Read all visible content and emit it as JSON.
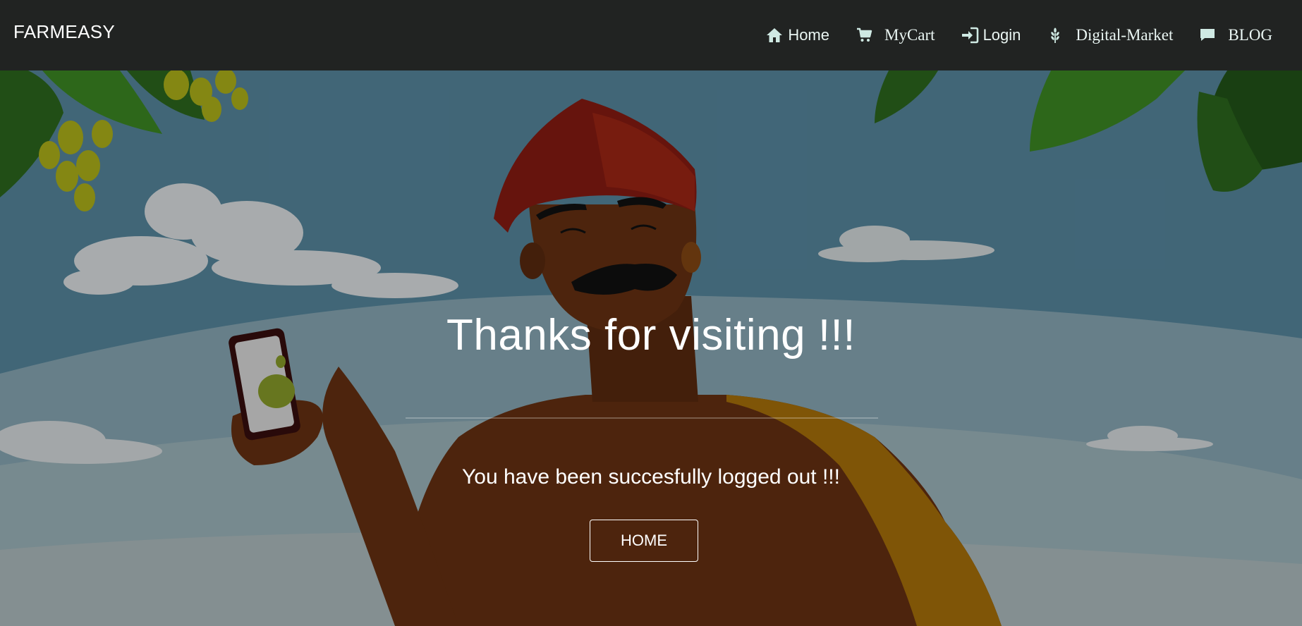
{
  "navbar": {
    "brand": "FARMEASY",
    "items": [
      {
        "label": "Home",
        "icon": "home-icon"
      },
      {
        "label": "MyCart",
        "icon": "cart-icon"
      },
      {
        "label": "Login",
        "icon": "login-icon"
      },
      {
        "label": "Digital-Market",
        "icon": "grain-icon"
      },
      {
        "label": "BLOG",
        "icon": "comment-icon"
      }
    ]
  },
  "hero": {
    "heading": "Thanks for visiting !!!",
    "message": "You have been succesfully logged out !!!",
    "button_label": "HOME"
  },
  "colors": {
    "navbar_bg": "#212322",
    "sky": "#4f7f95",
    "turban": "#8e1d12",
    "skin": "#6b3312",
    "leaf": "#2f6d1f"
  }
}
